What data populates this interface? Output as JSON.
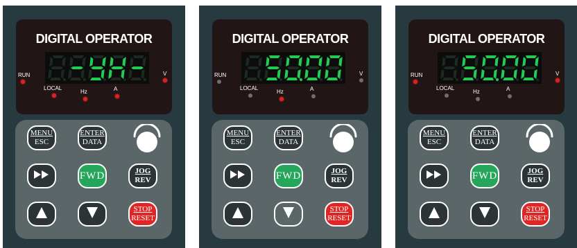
{
  "operators": [
    {
      "title": "DIGITAL OPERATOR",
      "display": "-YH-",
      "digit_color": "#22cc55",
      "leds": {
        "run": true,
        "v": true,
        "local": true,
        "hz": true,
        "a": true
      },
      "buttons": {
        "menu_top": "MENU",
        "menu_bot": "ESC",
        "enter_top": "ENTER",
        "enter_bot": "DATA",
        "fwd": "FWD",
        "jog_top": "JOG",
        "jog_bot": "REV",
        "stop_top": "STOP",
        "stop_bot": "RESET"
      },
      "down_pressed": false
    },
    {
      "title": "DIGITAL OPERATOR",
      "display": "50.00",
      "digit_color": "#22cc55",
      "leds": {
        "run": false,
        "v": false,
        "local": false,
        "hz": true,
        "a": false
      },
      "buttons": {
        "menu_top": "MENU",
        "menu_bot": "ESC",
        "enter_top": "ENTER",
        "enter_bot": "DATA",
        "fwd": "FWD",
        "jog_top": "JOG",
        "jog_bot": "REV",
        "stop_top": "STOP",
        "stop_bot": "RESET"
      },
      "down_pressed": true
    },
    {
      "title": "DIGITAL OPERATOR",
      "display": "50.00",
      "digit_color": "#22cc55",
      "leds": {
        "run": true,
        "v": true,
        "local": false,
        "hz": false,
        "a": false
      },
      "buttons": {
        "menu_top": "MENU",
        "menu_bot": "ESC",
        "enter_top": "ENTER",
        "enter_bot": "DATA",
        "fwd": "FWD",
        "jog_top": "JOG",
        "jog_bot": "REV",
        "stop_top": "STOP",
        "stop_bot": "RESET"
      },
      "down_pressed": false
    }
  ],
  "led_labels": {
    "run": "RUN",
    "local": "LOCAL",
    "hz": "Hz",
    "a": "A",
    "v": "V"
  },
  "icons": {
    "forward": "double-chevron-right-icon",
    "up": "up-triangle-icon",
    "down": "down-triangle-icon",
    "knob": "potentiometer-knob-icon"
  }
}
